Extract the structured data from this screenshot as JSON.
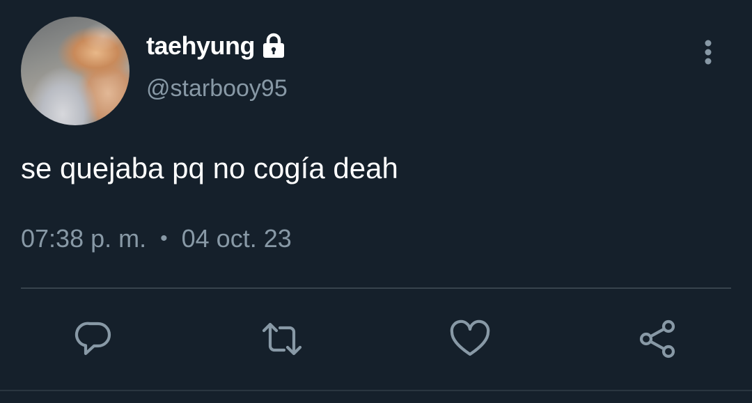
{
  "tweet": {
    "display_name": "taehyung",
    "handle": "@starbooy95",
    "text": "se quejaba pq no cogía deah",
    "time": "07:38 p. m.",
    "separator": "•",
    "date": "04 oct. 23"
  },
  "icons": {
    "lock": "lock-icon",
    "more": "more-vertical-icon",
    "reply": "reply-icon",
    "retweet": "retweet-icon",
    "like": "heart-icon",
    "share": "share-icon"
  },
  "colors": {
    "background": "#15202b",
    "text_primary": "#ffffff",
    "text_secondary": "#8899a6",
    "divider": "#38444d"
  }
}
